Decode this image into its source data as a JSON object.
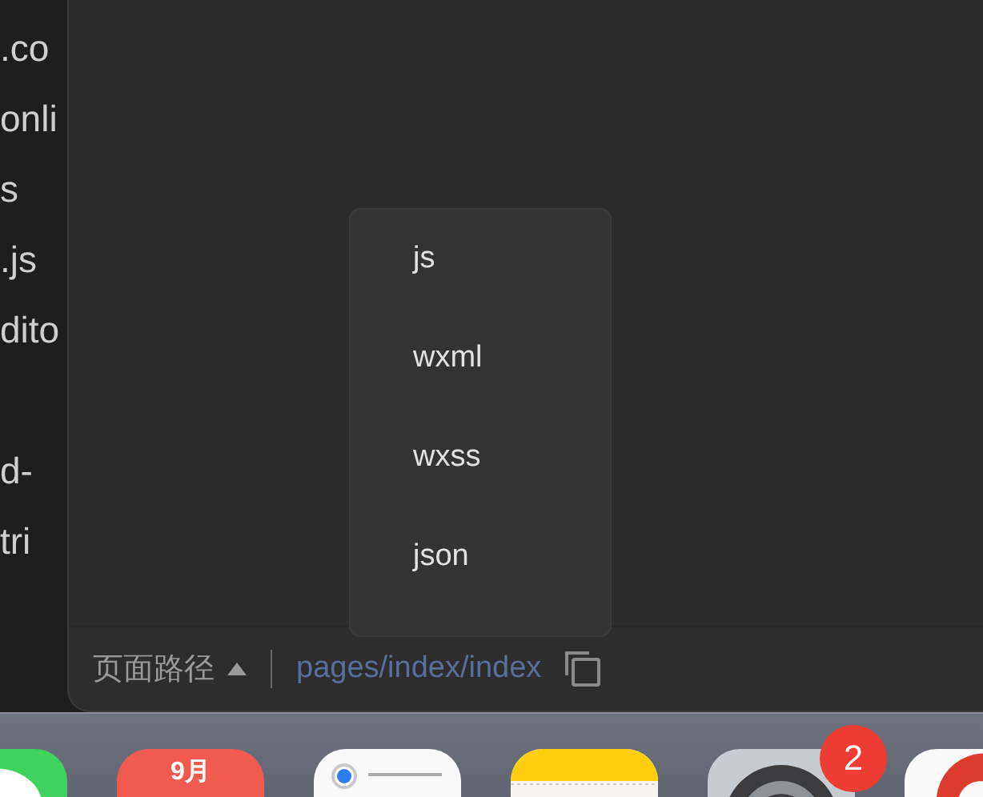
{
  "background_text": {
    "blocks": [
      {
        "lines": [
          ".co",
          "onli",
          "s",
          ".js",
          "dito"
        ]
      },
      {
        "lines": [
          "d-",
          "tri"
        ]
      }
    ]
  },
  "menu": {
    "items": [
      "js",
      "wxml",
      "wxss",
      "json"
    ]
  },
  "status_bar": {
    "label": "页面路径",
    "path": "pages/index/index"
  },
  "dock": {
    "items": [
      {
        "kind": "messages"
      },
      {
        "kind": "calendar",
        "text": "9月"
      },
      {
        "kind": "reminders"
      },
      {
        "kind": "notes"
      },
      {
        "kind": "settings",
        "badge": "2"
      },
      {
        "kind": "browser"
      }
    ]
  }
}
